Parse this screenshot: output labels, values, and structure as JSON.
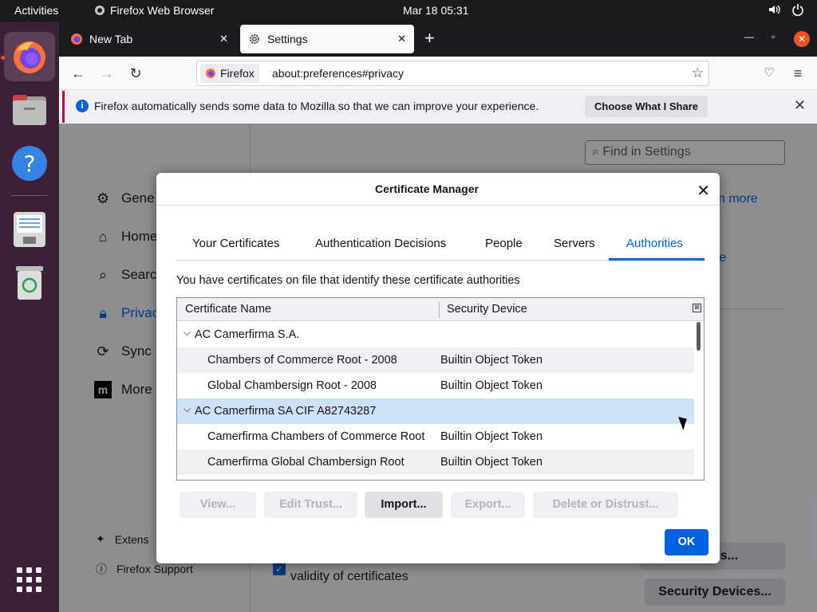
{
  "topbar": {
    "activities": "Activities",
    "app_name": "Firefox Web Browser",
    "clock": "Mar 18  05:31"
  },
  "dock": {
    "items": [
      "Firefox",
      "Files",
      "Help",
      "Text Editor",
      "Trash",
      "Show Applications"
    ]
  },
  "browser": {
    "tabs": [
      {
        "title": "New Tab",
        "active": false
      },
      {
        "title": "Settings",
        "active": true
      }
    ],
    "identity_label": "Firefox",
    "url": "about:preferences#privacy"
  },
  "notification": {
    "message": "Firefox automatically sends some data to Mozilla so that we can improve your experience.",
    "button": "Choose What I Share"
  },
  "prefs": {
    "find_placeholder": "Find in Settings",
    "sidebar": [
      {
        "label": "Gene",
        "icon": "gear-icon"
      },
      {
        "label": "Home",
        "icon": "home-icon"
      },
      {
        "label": "Searc",
        "icon": "search-icon"
      },
      {
        "label": "Privac",
        "icon": "lock-icon",
        "selected": true
      },
      {
        "label": "Sync",
        "icon": "sync-icon"
      },
      {
        "label": "More",
        "icon": "mozilla-icon"
      }
    ],
    "footer": {
      "extensions": "Extens",
      "support": "Firefox Support"
    },
    "learn_more_1": "n more",
    "learn_more_2": "re",
    "certificates_button": "ficates...",
    "security_devices_button": "Security Devices...",
    "validity_text": "validity of certificates"
  },
  "dialog": {
    "title": "Certificate Manager",
    "tabs": [
      "Your Certificates",
      "Authentication Decisions",
      "People",
      "Servers",
      "Authorities"
    ],
    "selected_tab": "Authorities",
    "description": "You have certificates on file that identify these certificate authorities",
    "columns": [
      "Certificate Name",
      "Security Device"
    ],
    "rows": [
      {
        "type": "group",
        "name": "AC Camerfirma S.A."
      },
      {
        "type": "cert",
        "name": "Chambers of Commerce Root - 2008",
        "device": "Builtin Object Token"
      },
      {
        "type": "cert",
        "name": "Global Chambersign Root - 2008",
        "device": "Builtin Object Token"
      },
      {
        "type": "group",
        "name": "AC Camerfirma SA CIF A82743287",
        "selected": true
      },
      {
        "type": "cert",
        "name": "Camerfirma Chambers of Commerce Root",
        "device": "Builtin Object Token"
      },
      {
        "type": "cert",
        "name": "Camerfirma Global Chambersign Root",
        "device": "Builtin Object Token"
      }
    ],
    "buttons": {
      "view": "View...",
      "edit_trust": "Edit Trust...",
      "import": "Import...",
      "export": "Export...",
      "delete": "Delete or Distrust...",
      "ok": "OK"
    }
  },
  "colors": {
    "accent": "#0061e0",
    "ubuntu_orange": "#e95420",
    "dock_bg": "#3c1f38",
    "selected_row": "#cfe1f6"
  }
}
